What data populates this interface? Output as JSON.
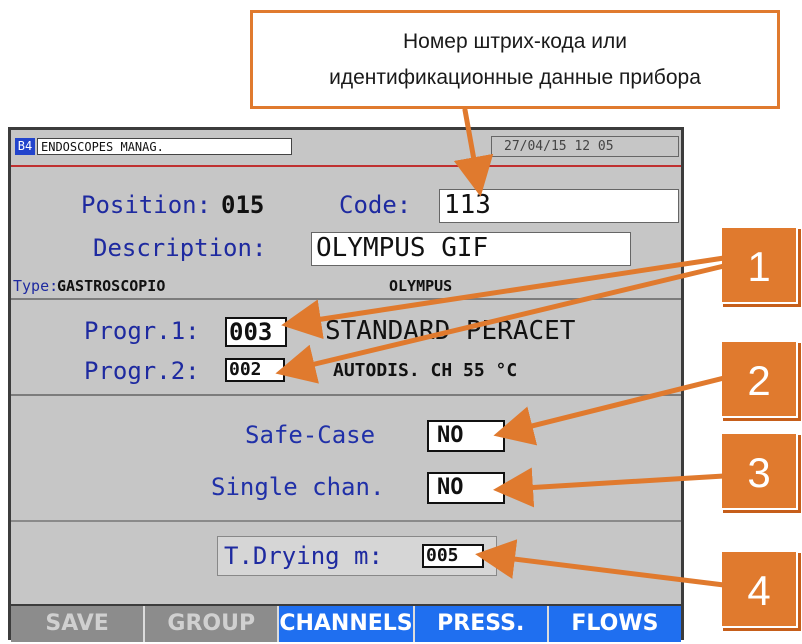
{
  "callout": {
    "line1": "Номер штрих-кода или",
    "line2": "идентификационные данные прибора"
  },
  "status": {
    "code": "B4",
    "title": "ENDOSCOPES MANAG.",
    "datetime": "27/04/15  12 05"
  },
  "form": {
    "position_label": "Position:",
    "position_value": "015",
    "code_label": "Code:",
    "code_value": "113",
    "description_label": "Description:",
    "description_value": "OLYMPUS GIF",
    "type_label": "Type:",
    "type_value": "GASTROSCOPIO",
    "brand": "OLYMPUS",
    "progr1_label": "Progr.1:",
    "progr1_value": "003",
    "progr1_name": "STANDARD PERACET",
    "progr2_label": "Progr.2:",
    "progr2_value": "002",
    "progr2_name": "AUTODIS. CH 55 °C",
    "safecase_label": "Safe-Case",
    "safecase_value": "NO",
    "singlechan_label": "Single chan.",
    "singlechan_value": "NO",
    "drying_label": "T.Drying m:",
    "drying_value": "005"
  },
  "buttons": {
    "save": "SAVE",
    "group": "GROUP",
    "channels": "CHANNELS",
    "press": "PRESS.",
    "flows": "FLOWS"
  },
  "markers": [
    "1",
    "2",
    "3",
    "4"
  ],
  "colors": {
    "accent": "#e07a2e",
    "button_active": "#1f6ff0",
    "button_inactive": "#8c8c8c",
    "label_text": "#1e2aa0"
  }
}
